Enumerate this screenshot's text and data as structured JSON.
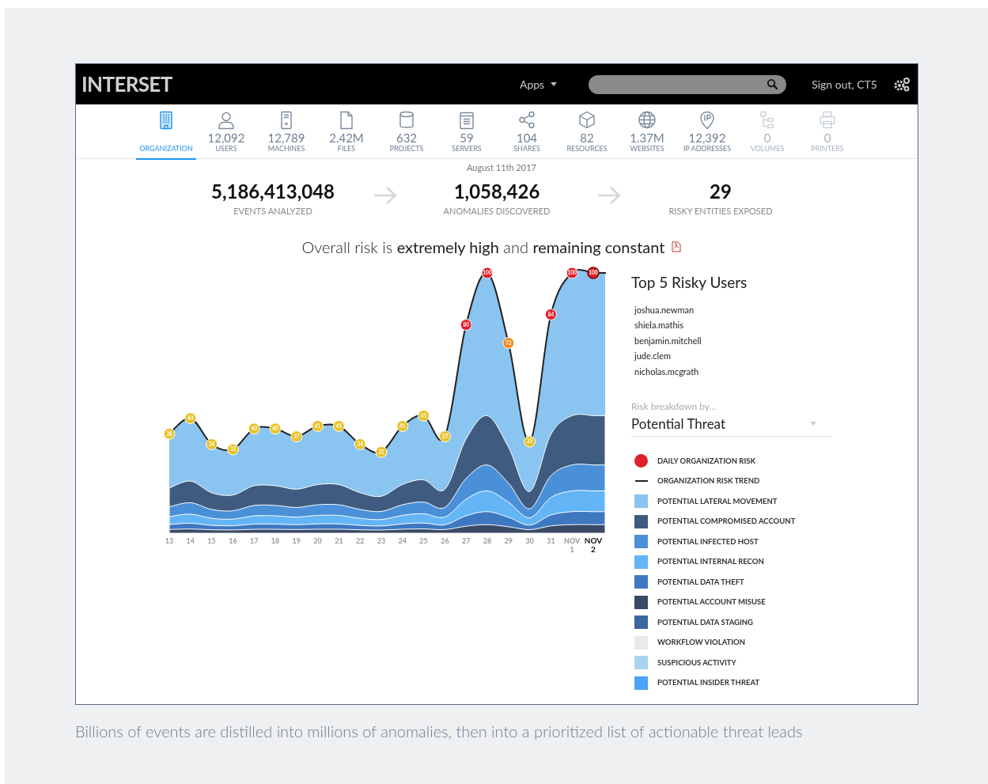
{
  "app": {
    "logo": "INTERSET",
    "apps_menu": "Apps",
    "sign_out": "Sign out, CT5"
  },
  "nav_tabs": [
    {
      "kind": "building",
      "label": "ORGANIZATION",
      "selected": true,
      "disabled": false
    },
    {
      "kind": "user",
      "count": "12,092",
      "label": "USERS",
      "selected": false,
      "disabled": false
    },
    {
      "kind": "machine",
      "count": "12,789",
      "label": "MACHINES",
      "selected": false,
      "disabled": false
    },
    {
      "kind": "file",
      "count": "2.42M",
      "label": "FILES",
      "selected": false,
      "disabled": false
    },
    {
      "kind": "database",
      "count": "632",
      "label": "PROJECTS",
      "selected": false,
      "disabled": false
    },
    {
      "kind": "server",
      "count": "59",
      "label": "SERVERS",
      "selected": false,
      "disabled": false
    },
    {
      "kind": "share",
      "count": "104",
      "label": "SHARES",
      "selected": false,
      "disabled": false
    },
    {
      "kind": "cube",
      "count": "82",
      "label": "RESOURCES",
      "selected": false,
      "disabled": false
    },
    {
      "kind": "globe",
      "count": "1.37M",
      "label": "WEBSITES",
      "selected": false,
      "disabled": false
    },
    {
      "kind": "pin",
      "count": "12,392",
      "label": "IP ADDRESSES",
      "selected": false,
      "disabled": false
    },
    {
      "kind": "tree",
      "count": "0",
      "label": "VOLUMES",
      "selected": false,
      "disabled": true
    },
    {
      "kind": "printer",
      "count": "0",
      "label": "PRINTERS",
      "selected": false,
      "disabled": true
    }
  ],
  "date": "August 11th 2017",
  "stats": [
    {
      "value": "5,186,413,048",
      "label": "EVENTS ANALYZED"
    },
    {
      "value": "1,058,426",
      "label": "ANOMALIES DISCOVERED"
    },
    {
      "value": "29",
      "label": "RISKY ENTITIES EXPOSED"
    }
  ],
  "headline": "Overall risk is **extremely high** and **remaining constant**",
  "risk_chart": {
    "chart_data": {
      "type": "area",
      "categories": [
        "13",
        "14",
        "15",
        "16",
        "17",
        "18",
        "19",
        "20",
        "21",
        "22",
        "23",
        "24",
        "25",
        "26",
        "27",
        "28",
        "29",
        "30",
        "31",
        "NOV 1",
        "NOV 2"
      ],
      "series": [
        {
          "name": "ORGANIZATION RISK TREND",
          "color": "#8ac4f0",
          "marker": "circle",
          "values": [
            38,
            44,
            34,
            32,
            40,
            40,
            37,
            41,
            41,
            34,
            31,
            41,
            45,
            37,
            80,
            100,
            73,
            35,
            84,
            100,
            100
          ]
        }
      ],
      "data_labels": true
    },
    "points": [
      {
        "selected": false
      },
      {
        "selected": false
      },
      {
        "selected": false
      },
      {
        "selected": false
      },
      {
        "selected": false
      },
      {
        "selected": false
      },
      {
        "selected": false
      },
      {
        "selected": false
      },
      {
        "selected": false
      },
      {
        "selected": false
      },
      {
        "selected": false
      },
      {
        "selected": false
      },
      {
        "selected": false
      },
      {
        "selected": false
      },
      {
        "selected": false
      },
      {
        "selected": false
      },
      {
        "selected": false
      },
      {
        "selected": false
      },
      {
        "selected": false
      },
      {
        "selected": false
      },
      {
        "selected": true
      }
    ]
  },
  "top_users": {
    "title": "Top 5 Risky Users",
    "users": [
      "joshua.newman",
      "shiela.mathis",
      "benjamin.mitchell",
      "jude.clem",
      "nicholas.mcgrath"
    ]
  },
  "breakdown": {
    "label": "Risk breakdown by...",
    "value": "Potential Threat"
  },
  "legend": [
    {
      "kind": "dot",
      "color": "#e0202a",
      "label": "DAILY ORGANIZATION RISK"
    },
    {
      "kind": "square",
      "color": "#8ac4f0",
      "label": "POTENTIAL LATERAL MOVEMENT"
    },
    {
      "kind": "square",
      "color": "#3f5c80",
      "label": "POTENTIAL COMPROMISED ACCOUNT"
    },
    {
      "kind": "square",
      "color": "#4a90d9",
      "label": "POTENTIAL INFECTED HOST"
    },
    {
      "kind": "square",
      "color": "#64b5f6",
      "label": "POTENTIAL INTERNAL RECON"
    },
    {
      "kind": "square",
      "color": "#3e78c0",
      "label": "POTENTIAL DATA THEFT"
    },
    {
      "kind": "square",
      "color": "#3b4a66",
      "label": "POTENTIAL ACCOUNT MISUSE"
    },
    {
      "kind": "square",
      "color": "#3b66a0",
      "label": "POTENTIAL DATA STAGING"
    },
    {
      "kind": "square",
      "color": "#e8eaed",
      "label": "WORKFLOW VIOLATION"
    },
    {
      "kind": "square",
      "color": "#a8d4f0",
      "label": "SUSPICIOUS ACTIVITY"
    },
    {
      "kind": "square",
      "color": "#4aa3f5",
      "label": "POTENTIAL INSIDER THREAT"
    }
  ],
  "caption": "Billions of events are distilled into millions of anomalies, then into a prioritized list of actionable threat leads"
}
